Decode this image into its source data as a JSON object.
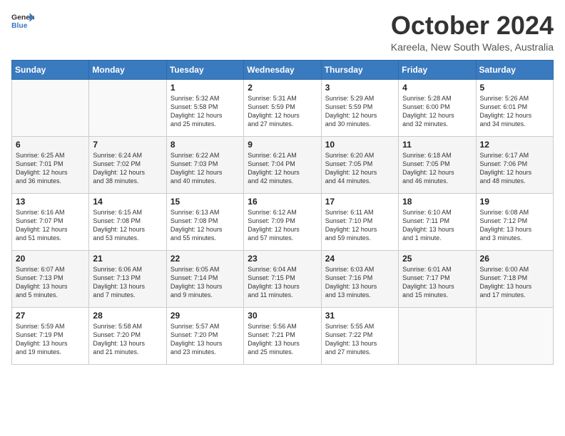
{
  "header": {
    "logo_line1": "General",
    "logo_line2": "Blue",
    "month": "October 2024",
    "location": "Kareela, New South Wales, Australia"
  },
  "days_of_week": [
    "Sunday",
    "Monday",
    "Tuesday",
    "Wednesday",
    "Thursday",
    "Friday",
    "Saturday"
  ],
  "weeks": [
    [
      {
        "day": "",
        "info": ""
      },
      {
        "day": "",
        "info": ""
      },
      {
        "day": "1",
        "info": "Sunrise: 5:32 AM\nSunset: 5:58 PM\nDaylight: 12 hours\nand 25 minutes."
      },
      {
        "day": "2",
        "info": "Sunrise: 5:31 AM\nSunset: 5:59 PM\nDaylight: 12 hours\nand 27 minutes."
      },
      {
        "day": "3",
        "info": "Sunrise: 5:29 AM\nSunset: 5:59 PM\nDaylight: 12 hours\nand 30 minutes."
      },
      {
        "day": "4",
        "info": "Sunrise: 5:28 AM\nSunset: 6:00 PM\nDaylight: 12 hours\nand 32 minutes."
      },
      {
        "day": "5",
        "info": "Sunrise: 5:26 AM\nSunset: 6:01 PM\nDaylight: 12 hours\nand 34 minutes."
      }
    ],
    [
      {
        "day": "6",
        "info": "Sunrise: 6:25 AM\nSunset: 7:01 PM\nDaylight: 12 hours\nand 36 minutes."
      },
      {
        "day": "7",
        "info": "Sunrise: 6:24 AM\nSunset: 7:02 PM\nDaylight: 12 hours\nand 38 minutes."
      },
      {
        "day": "8",
        "info": "Sunrise: 6:22 AM\nSunset: 7:03 PM\nDaylight: 12 hours\nand 40 minutes."
      },
      {
        "day": "9",
        "info": "Sunrise: 6:21 AM\nSunset: 7:04 PM\nDaylight: 12 hours\nand 42 minutes."
      },
      {
        "day": "10",
        "info": "Sunrise: 6:20 AM\nSunset: 7:05 PM\nDaylight: 12 hours\nand 44 minutes."
      },
      {
        "day": "11",
        "info": "Sunrise: 6:18 AM\nSunset: 7:05 PM\nDaylight: 12 hours\nand 46 minutes."
      },
      {
        "day": "12",
        "info": "Sunrise: 6:17 AM\nSunset: 7:06 PM\nDaylight: 12 hours\nand 48 minutes."
      }
    ],
    [
      {
        "day": "13",
        "info": "Sunrise: 6:16 AM\nSunset: 7:07 PM\nDaylight: 12 hours\nand 51 minutes."
      },
      {
        "day": "14",
        "info": "Sunrise: 6:15 AM\nSunset: 7:08 PM\nDaylight: 12 hours\nand 53 minutes."
      },
      {
        "day": "15",
        "info": "Sunrise: 6:13 AM\nSunset: 7:08 PM\nDaylight: 12 hours\nand 55 minutes."
      },
      {
        "day": "16",
        "info": "Sunrise: 6:12 AM\nSunset: 7:09 PM\nDaylight: 12 hours\nand 57 minutes."
      },
      {
        "day": "17",
        "info": "Sunrise: 6:11 AM\nSunset: 7:10 PM\nDaylight: 12 hours\nand 59 minutes."
      },
      {
        "day": "18",
        "info": "Sunrise: 6:10 AM\nSunset: 7:11 PM\nDaylight: 13 hours\nand 1 minute."
      },
      {
        "day": "19",
        "info": "Sunrise: 6:08 AM\nSunset: 7:12 PM\nDaylight: 13 hours\nand 3 minutes."
      }
    ],
    [
      {
        "day": "20",
        "info": "Sunrise: 6:07 AM\nSunset: 7:13 PM\nDaylight: 13 hours\nand 5 minutes."
      },
      {
        "day": "21",
        "info": "Sunrise: 6:06 AM\nSunset: 7:13 PM\nDaylight: 13 hours\nand 7 minutes."
      },
      {
        "day": "22",
        "info": "Sunrise: 6:05 AM\nSunset: 7:14 PM\nDaylight: 13 hours\nand 9 minutes."
      },
      {
        "day": "23",
        "info": "Sunrise: 6:04 AM\nSunset: 7:15 PM\nDaylight: 13 hours\nand 11 minutes."
      },
      {
        "day": "24",
        "info": "Sunrise: 6:03 AM\nSunset: 7:16 PM\nDaylight: 13 hours\nand 13 minutes."
      },
      {
        "day": "25",
        "info": "Sunrise: 6:01 AM\nSunset: 7:17 PM\nDaylight: 13 hours\nand 15 minutes."
      },
      {
        "day": "26",
        "info": "Sunrise: 6:00 AM\nSunset: 7:18 PM\nDaylight: 13 hours\nand 17 minutes."
      }
    ],
    [
      {
        "day": "27",
        "info": "Sunrise: 5:59 AM\nSunset: 7:19 PM\nDaylight: 13 hours\nand 19 minutes."
      },
      {
        "day": "28",
        "info": "Sunrise: 5:58 AM\nSunset: 7:20 PM\nDaylight: 13 hours\nand 21 minutes."
      },
      {
        "day": "29",
        "info": "Sunrise: 5:57 AM\nSunset: 7:20 PM\nDaylight: 13 hours\nand 23 minutes."
      },
      {
        "day": "30",
        "info": "Sunrise: 5:56 AM\nSunset: 7:21 PM\nDaylight: 13 hours\nand 25 minutes."
      },
      {
        "day": "31",
        "info": "Sunrise: 5:55 AM\nSunset: 7:22 PM\nDaylight: 13 hours\nand 27 minutes."
      },
      {
        "day": "",
        "info": ""
      },
      {
        "day": "",
        "info": ""
      }
    ]
  ]
}
